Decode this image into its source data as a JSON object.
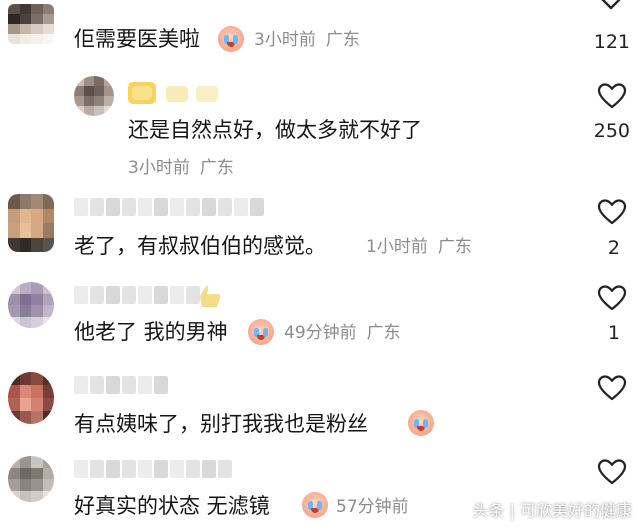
{
  "comments": [
    {
      "id": "c1",
      "text": "佢需要医美啦",
      "has_emoji": true,
      "emoji": "crying-face",
      "time": "3小时前",
      "location": "广东",
      "likes": "121",
      "inline_meta": true
    },
    {
      "id": "c2",
      "text": "还是自然点好，做太多就不好了",
      "has_emoji": false,
      "time": "3小时前",
      "location": "广东",
      "likes": "250",
      "inline_meta": false,
      "is_reply": true
    },
    {
      "id": "c3",
      "text": "老了，有叔叔伯伯的感觉。",
      "has_emoji": false,
      "time": "1小时前",
      "location": "广东",
      "likes": "2",
      "inline_meta": true
    },
    {
      "id": "c4",
      "text": "他老了 我的男神",
      "has_emoji": true,
      "emoji": "crying-face",
      "time": "49分钟前",
      "location": "广东",
      "likes": "1",
      "inline_meta": true
    },
    {
      "id": "c5",
      "text": "有点姨味了，别打我我也是粉丝",
      "has_emoji": true,
      "emoji": "crying-face",
      "time": "",
      "location": "",
      "likes": "",
      "inline_meta": false
    },
    {
      "id": "c6",
      "text": "好真实的状态 无滤镜",
      "has_emoji": true,
      "emoji": "crying-face",
      "time": "57分钟前",
      "location": "",
      "likes": "",
      "inline_meta": true
    }
  ],
  "icons": {
    "like": "heart-outline-icon",
    "chevron": "chevron-down-icon"
  },
  "colors": {
    "text": "#161616",
    "meta": "#8c8c8c",
    "background": "#ffffff"
  },
  "watermark": "头条 | 可欣美好的健康"
}
